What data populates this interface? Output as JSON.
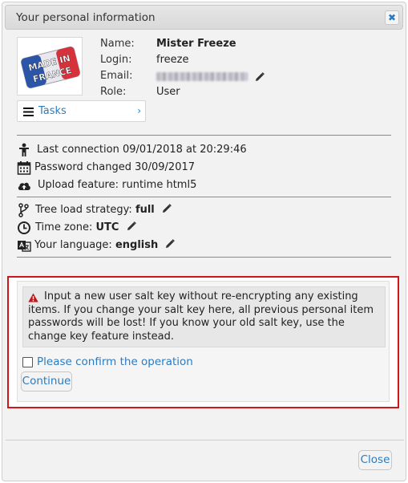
{
  "dialog": {
    "title": "Your personal information",
    "close_icon": "close-icon"
  },
  "profile": {
    "avatar_text": [
      "MADE IN",
      "FRANCE"
    ],
    "name_label": "Name:",
    "name_value": "Mister Freeze",
    "login_label": "Login:",
    "login_value": "freeze",
    "email_label": "Email:",
    "role_label": "Role:",
    "role_value": "User"
  },
  "tasks": {
    "label": "Tasks",
    "chevron": "›"
  },
  "stats": {
    "last_connection": "Last connection 09/01/2018 at 20:29:46",
    "password_changed": "Password changed 30/09/2017",
    "upload_feature": "Upload feature: runtime html5"
  },
  "prefs": {
    "tree_label": "Tree load strategy:",
    "tree_value": "full",
    "tz_label": "Time zone:",
    "tz_value": "UTC",
    "lang_label": "Your language:",
    "lang_value": "english"
  },
  "salt": {
    "warning": "Input a new user salt key without re-encrypting any existing items. If you change your salt key here, all previous personal item passwords will be lost! If you know your old salt key, use the change key feature instead.",
    "confirm_label": "Please confirm the operation",
    "continue_label": "Continue"
  },
  "footer": {
    "close_label": "Close"
  },
  "colors": {
    "accent": "#2d7bbf",
    "highlight": "#d0161b",
    "warning_icon": "#c0171a"
  }
}
